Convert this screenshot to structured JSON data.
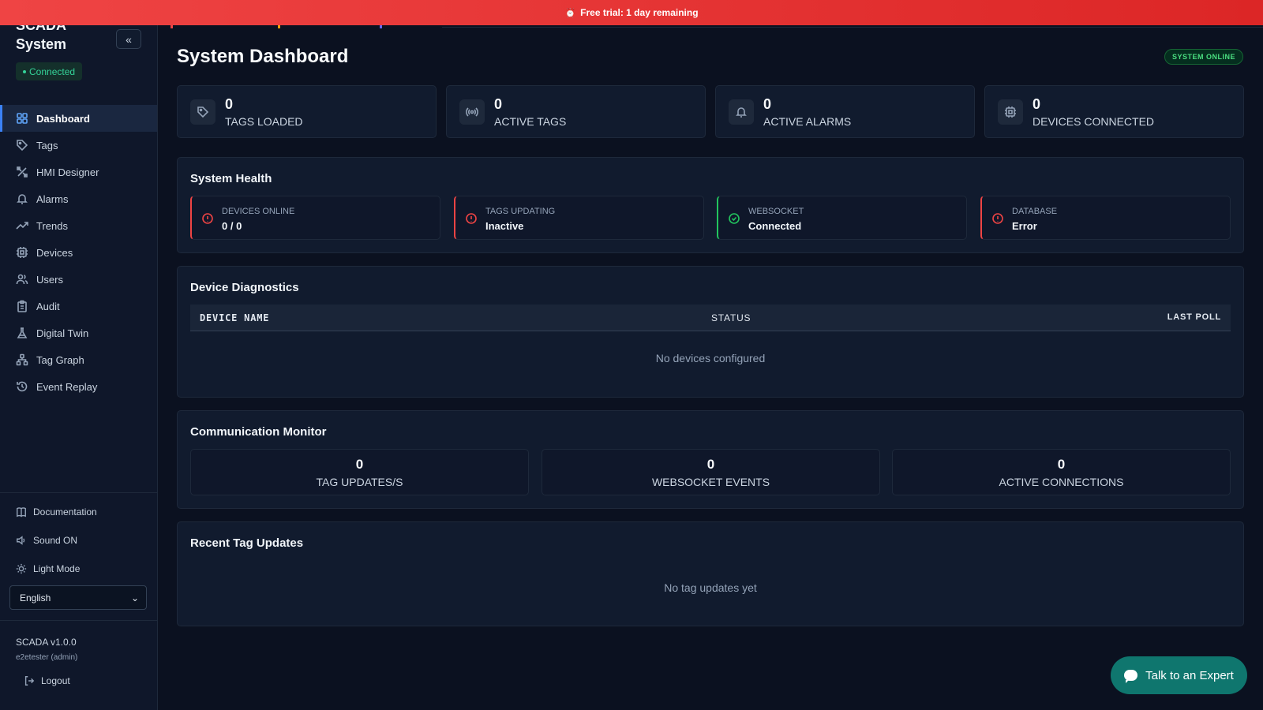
{
  "banner": {
    "icon": "alarm-clock-icon",
    "text": "Free trial: 1 day remaining"
  },
  "sidebar": {
    "brand": "SCADA System",
    "collapse_icon": "chevrons-left-icon",
    "connection_status": "Connected",
    "items": [
      {
        "label": "Dashboard",
        "icon": "dashboard-icon",
        "active": true
      },
      {
        "label": "Tags",
        "icon": "tag-icon"
      },
      {
        "label": "HMI Designer",
        "icon": "design-tools-icon"
      },
      {
        "label": "Alarms",
        "icon": "bell-icon"
      },
      {
        "label": "Trends",
        "icon": "trend-up-icon"
      },
      {
        "label": "Devices",
        "icon": "cpu-icon"
      },
      {
        "label": "Users",
        "icon": "users-icon"
      },
      {
        "label": "Audit",
        "icon": "clipboard-icon"
      },
      {
        "label": "Digital Twin",
        "icon": "flask-icon"
      },
      {
        "label": "Tag Graph",
        "icon": "network-icon"
      },
      {
        "label": "Event Replay",
        "icon": "history-icon"
      }
    ],
    "documentation": "Documentation",
    "sound": "Sound ON",
    "theme": "Light Mode",
    "language": "English",
    "version": "SCADA v1.0.0",
    "user": "e2etester (admin)",
    "logout": "Logout"
  },
  "header": {
    "title": "System Dashboard",
    "status_badge": "SYSTEM ONLINE"
  },
  "stats": [
    {
      "value": "0",
      "label": "TAGS LOADED",
      "icon": "tag-icon"
    },
    {
      "value": "0",
      "label": "ACTIVE TAGS",
      "icon": "radio-signal-icon"
    },
    {
      "value": "0",
      "label": "ACTIVE ALARMS",
      "icon": "bell-icon"
    },
    {
      "value": "0",
      "label": "DEVICES CONNECTED",
      "icon": "cpu-icon"
    }
  ],
  "health": {
    "title": "System Health",
    "items": [
      {
        "label": "DEVICES ONLINE",
        "value": "0 / 0",
        "status": "error"
      },
      {
        "label": "TAGS UPDATING",
        "value": "Inactive",
        "status": "error"
      },
      {
        "label": "WEBSOCKET",
        "value": "Connected",
        "status": "ok"
      },
      {
        "label": "DATABASE",
        "value": "Error",
        "status": "error"
      }
    ]
  },
  "diagnostics": {
    "title": "Device Diagnostics",
    "columns": [
      "DEVICE NAME",
      "STATUS",
      "LAST POLL"
    ],
    "empty": "No devices configured"
  },
  "comm": {
    "title": "Communication Monitor",
    "items": [
      {
        "value": "0",
        "label": "TAG UPDATES/S"
      },
      {
        "value": "0",
        "label": "WEBSOCKET EVENTS"
      },
      {
        "value": "0",
        "label": "ACTIVE CONNECTIONS"
      }
    ]
  },
  "recent": {
    "title": "Recent Tag Updates",
    "empty": "No tag updates yet"
  },
  "expert_button": "Talk to an Expert",
  "colors": {
    "accent": "#3b82f6",
    "error": "#ef4444",
    "ok": "#22c55e",
    "banner": "#ef4444",
    "expert": "#0f766e"
  }
}
